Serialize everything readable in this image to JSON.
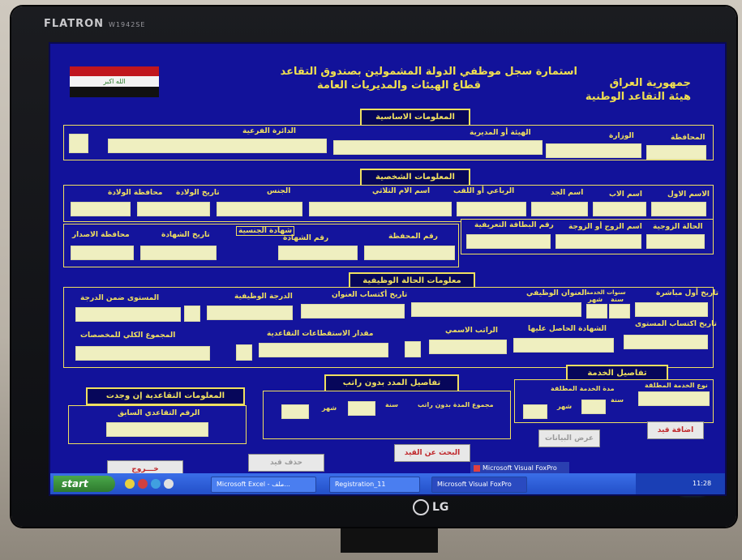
{
  "monitor": {
    "brand": "FLATRON",
    "model": "W1942SE",
    "logo": "LG"
  },
  "header": {
    "title_line1": "استمارة سجل موظفي الدولة المشمولين بصندوق التقاعد",
    "title_line2": "قطاع الهيئات والمديريات العامة",
    "country_line1": "جمهورية العراق",
    "country_line2": "هيئة التقاعد الوطنية",
    "flag_text": "الله اكبر"
  },
  "sections": {
    "basic": "المعلومات الاساسية",
    "personal": "المعلومات الشخصية",
    "job": "معلومات الحالة الوظيفية",
    "retired": "المعلومات التقاعدية إن وجدت",
    "unpaid": "تفاصيل المدد بدون راتب",
    "service": "تفاصيل الخدمة المطلقة"
  },
  "labels": {
    "governorate": "المحافظة",
    "ministry": "الوزارة",
    "authority": "الهيئة أو المديرية",
    "branch_dept": "الدائرة الفرعية",
    "first_name": "الاسم الاول",
    "father_name": "اسم الاب",
    "grandfather_name": "اسم الجد",
    "fourth_name": "الرباعي أو اللقب",
    "mother_name": "اسم الام الثلاثي",
    "gender": "الجنس",
    "birth_date": "تاريخ الولادة",
    "birth_gov": "محافظة الولادة",
    "marital_status": "الحالة الزوجية",
    "spouse_name": "اسم الزوج أو الزوجة",
    "id_card_no": "رقم البطاقة التعريفية",
    "file_no": "رقم المحفظة",
    "certificate_no": "رقم الشهادة",
    "nationality_cert": "شهادة الجنسية",
    "cert_date": "تاريخ الشهادة",
    "issue_gov": "محافظة الاصدار",
    "first_start_date": "تاريخ أول مباشرة",
    "service_years": "سنوات الخدمة",
    "year": "سنة",
    "month": "شهر",
    "job_title": "العنوان الوظيفي",
    "title_date": "تاريخ أكتساب العنوان",
    "job_grade": "الدرجة الوظيفية",
    "grade_level": "المستوى ضمن الدرجة",
    "level_date": "تاريخ اكتساب المستوى",
    "certificate": "الشهادة الحاصل عليها",
    "nominal_salary": "الراتب الاسمي",
    "retirement_deductions": "مقدار الاستقطاعات التقاعدية",
    "total_allowances": "المجموع الكلي للمخصصات",
    "prev_retirement_no": "الرقم التقاعدي السابق",
    "unpaid_total": "مجموع المدة بدون راتب",
    "absolute_service_type": "نوع الخدمة المطلقة",
    "absolute_service_period": "مدة الخدمة المطلقة"
  },
  "buttons": {
    "exit": "خـــروج",
    "delete": "حذف قيد",
    "search": "البحث عن القيد",
    "show_data": "عرض البيانات",
    "add": "اضافة قيد"
  },
  "taskbar": {
    "start": "start",
    "tasks": [
      "Microsoft Excel - ملف...",
      "Registration_11",
      "Microsoft Visual FoxPro"
    ],
    "active_task_label": "Microsoft Visual FoxPro",
    "tray_time": "11:28"
  },
  "colors": {
    "screen_bg": "#12129a",
    "label": "#f0e060",
    "field": "#efefc0",
    "button_text": "#c0282c",
    "taskbar": "#2a5ad8"
  }
}
